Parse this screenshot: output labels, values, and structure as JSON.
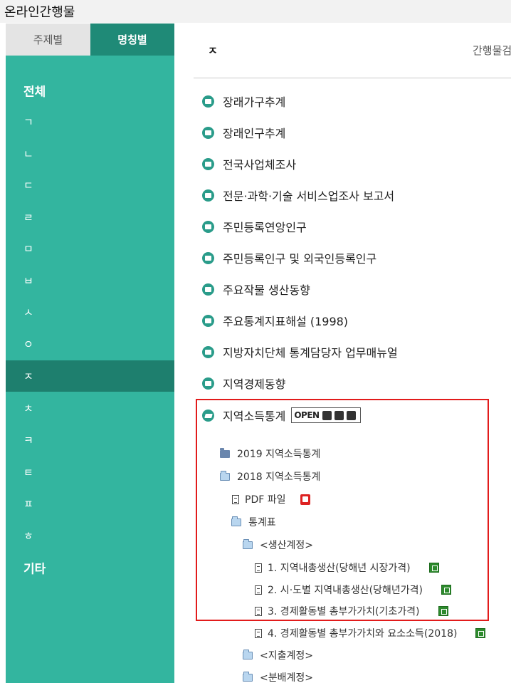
{
  "app_title": "온라인간행물",
  "tabs": {
    "by_subject": "주제별",
    "by_name": "명칭별"
  },
  "sidebar": {
    "items": [
      {
        "label": "전체"
      },
      {
        "label": "ㄱ"
      },
      {
        "label": "ㄴ"
      },
      {
        "label": "ㄷ"
      },
      {
        "label": "ㄹ"
      },
      {
        "label": "ㅁ"
      },
      {
        "label": "ㅂ"
      },
      {
        "label": "ㅅ"
      },
      {
        "label": "ㅇ"
      },
      {
        "label": "ㅈ"
      },
      {
        "label": "ㅊ"
      },
      {
        "label": "ㅋ"
      },
      {
        "label": "ㅌ"
      },
      {
        "label": "ㅍ"
      },
      {
        "label": "ㅎ"
      },
      {
        "label": "기타"
      }
    ],
    "active": "ㅈ"
  },
  "main": {
    "current_letter": "ㅈ",
    "search_label": "간행물검",
    "publications": [
      {
        "label": "장래가구추계"
      },
      {
        "label": "장래인구추계"
      },
      {
        "label": "전국사업체조사"
      },
      {
        "label": "전문·과학·기술 서비스업조사 보고서"
      },
      {
        "label": "주민등록연앙인구"
      },
      {
        "label": "주민등록인구 및 외국인등록인구"
      },
      {
        "label": "주요작물 생산동향"
      },
      {
        "label": "주요통계지표해설 (1998)"
      },
      {
        "label": "지방자치단체 통계담당자 업무매뉴얼"
      },
      {
        "label": "지역경제동향"
      },
      {
        "label": "지역소득통계"
      }
    ],
    "badge_text": "OPEN",
    "tree": {
      "y2019": "2019 지역소득통계",
      "y2018": "2018 지역소득통계",
      "pdf": "PDF 파일",
      "stats": "통계표",
      "production": "<생산계정>",
      "items": [
        "1. 지역내총생산(당해년 시장가격)",
        "2. 시·도별 지역내총생산(당해년가격)",
        "3. 경제활동별 총부가가치(기초가격)",
        "4. 경제활동별 총부가가치와 요소소득(2018)"
      ],
      "expenditure": "<지출계정>",
      "distribution": "<분배계정>"
    }
  },
  "colors": {
    "sidebar_bg": "#33b59f",
    "sidebar_active": "#1e7f6e",
    "highlight": "#e21b1b"
  }
}
